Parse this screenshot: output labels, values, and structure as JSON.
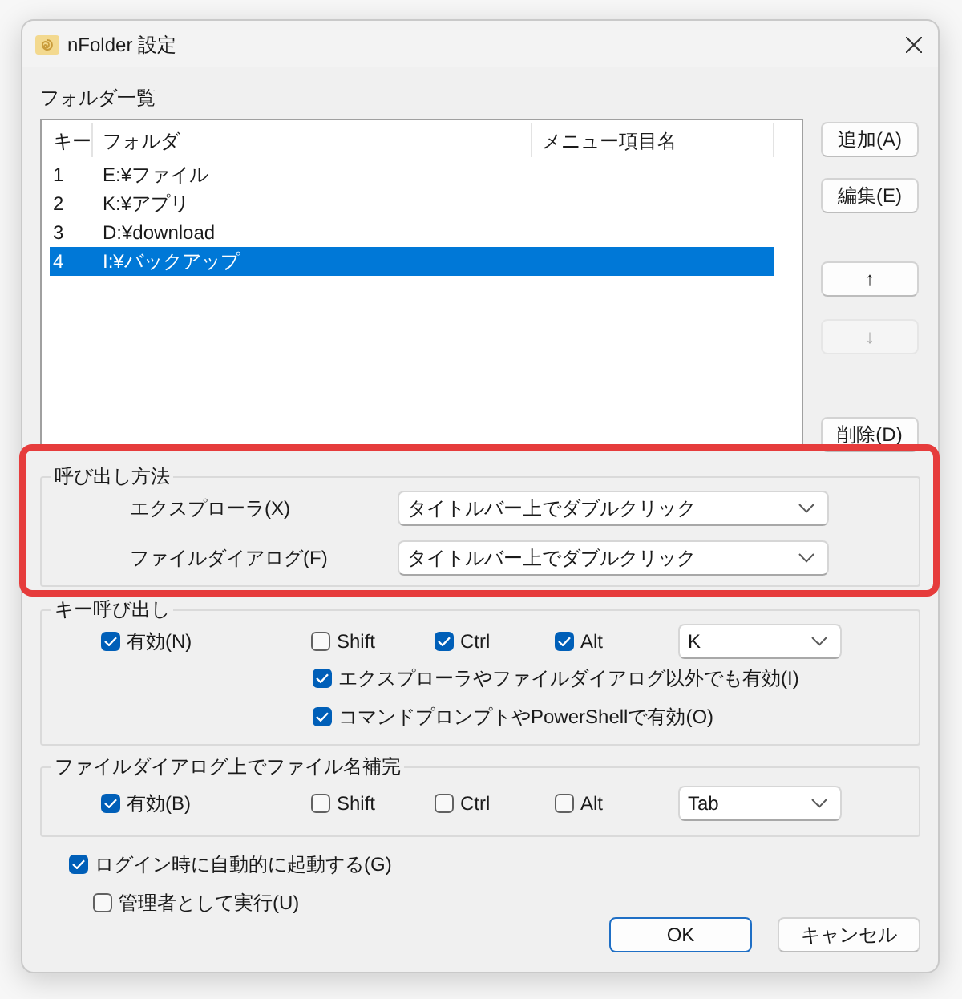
{
  "window": {
    "title": "nFolder 設定"
  },
  "folder_list": {
    "label": "フォルダ一覧",
    "columns": [
      "キー",
      "フォルダ",
      "メニュー項目名"
    ],
    "rows": [
      {
        "key": "1",
        "folder": "E:¥ファイル",
        "selected": false
      },
      {
        "key": "2",
        "folder": "K:¥アプリ",
        "selected": false
      },
      {
        "key": "3",
        "folder": "D:¥download",
        "selected": false
      },
      {
        "key": "4",
        "folder": "I:¥バックアップ",
        "selected": true
      }
    ]
  },
  "list_buttons": {
    "edit": [
      {
        "label": "追加(A)",
        "disabled": false
      },
      {
        "label": "編集(E)",
        "disabled": false
      }
    ],
    "move": [
      {
        "label": "↑",
        "disabled": false
      },
      {
        "label": "↓",
        "disabled": true
      }
    ],
    "remove": {
      "label": "削除(D)",
      "disabled": false
    }
  },
  "invoke_method": {
    "title": "呼び出し方法",
    "rows": [
      {
        "label": "エクスプローラ(X)",
        "value": "タイトルバー上でダブルクリック"
      },
      {
        "label": "ファイルダイアログ(F)",
        "value": "タイトルバー上でダブルクリック"
      }
    ]
  },
  "key_invoke": {
    "title": "キー呼び出し",
    "enabled": {
      "label": "有効(N)",
      "checked": true
    },
    "modifiers": [
      {
        "label": "Shift",
        "checked": false
      },
      {
        "label": "Ctrl",
        "checked": true
      },
      {
        "label": "Alt",
        "checked": true
      }
    ],
    "key": {
      "value": "K"
    },
    "options": [
      {
        "label": "エクスプローラやファイルダイアログ以外でも有効(I)",
        "checked": true
      },
      {
        "label": "コマンドプロンプトやPowerShellで有効(O)",
        "checked": true
      }
    ]
  },
  "filename_completion": {
    "title": "ファイルダイアログ上でファイル名補完",
    "enabled": {
      "label": "有効(B)",
      "checked": true
    },
    "modifiers": [
      {
        "label": "Shift",
        "checked": false
      },
      {
        "label": "Ctrl",
        "checked": false
      },
      {
        "label": "Alt",
        "checked": false
      }
    ],
    "key": {
      "value": "Tab"
    }
  },
  "startup": [
    {
      "label": "ログイン時に自動的に起動する(G)",
      "checked": true,
      "children": [
        {
          "label": "管理者として実行(U)",
          "checked": false
        }
      ]
    }
  ],
  "buttons": [
    {
      "label": "OK",
      "default": true
    },
    {
      "label": "キャンセル",
      "default": false
    }
  ]
}
